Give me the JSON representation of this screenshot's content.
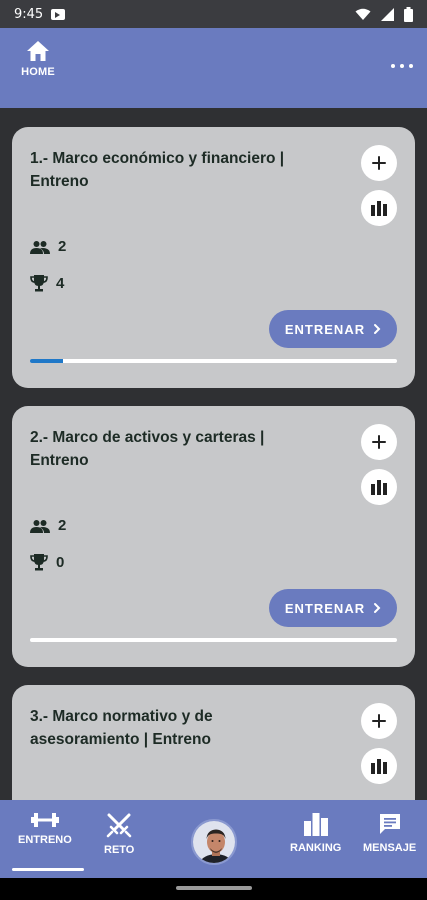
{
  "status_bar": {
    "time": "9:45"
  },
  "header": {
    "home_label": "HOME"
  },
  "cards": [
    {
      "title": "1.- Marco económico y financiero | Entreno",
      "users": "2",
      "trophies": "4",
      "button": "ENTRENAR",
      "progress": 0.09
    },
    {
      "title": "2.- Marco de activos y carteras | Entreno",
      "users": "2",
      "trophies": "0",
      "button": "ENTRENAR",
      "progress": 0.0
    },
    {
      "title": "3.- Marco normativo y de asesoramiento | Entreno"
    }
  ],
  "bottom_nav": {
    "items": [
      {
        "label": "ENTRENO",
        "icon": "dumbbell-icon"
      },
      {
        "label": "RETO",
        "icon": "crossed-swords-icon"
      },
      {
        "label": "RANKING",
        "icon": "bar-chart-icon"
      },
      {
        "label": "MENSAJE",
        "icon": "message-icon"
      }
    ]
  },
  "colors": {
    "accent": "#6a7bbf",
    "progress": "#1f78c8",
    "card": "#c7c8ca",
    "background": "#2f3033"
  }
}
